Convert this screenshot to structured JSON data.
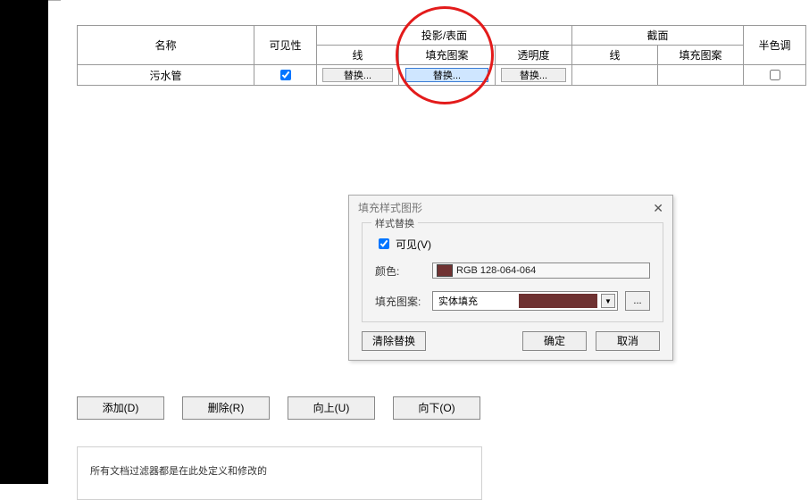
{
  "table": {
    "headers": {
      "name": "名称",
      "visibility": "可见性",
      "projection_surface": "投影/表面",
      "section": "截面",
      "halftone": "半色调",
      "line": "线",
      "fill_pattern": "填充图案",
      "transparency": "透明度"
    },
    "row": {
      "name": "污水管",
      "replace": "替换..."
    }
  },
  "dialog": {
    "title": "填充样式图形",
    "group_label": "样式替换",
    "visible_label": "可见(V)",
    "color_label": "颜色:",
    "color_value": "RGB 128-064-064",
    "color_hex": "#6f3232",
    "pattern_label": "填充图案:",
    "pattern_value": "实体填充",
    "dots": "...",
    "clear": "清除替换",
    "ok": "确定",
    "cancel": "取消"
  },
  "main_buttons": {
    "add": "添加(D)",
    "delete": "删除(R)",
    "up": "向上(U)",
    "down": "向下(O)"
  },
  "bottom_text": "所有文档过滤器都是在此处定义和修改的"
}
